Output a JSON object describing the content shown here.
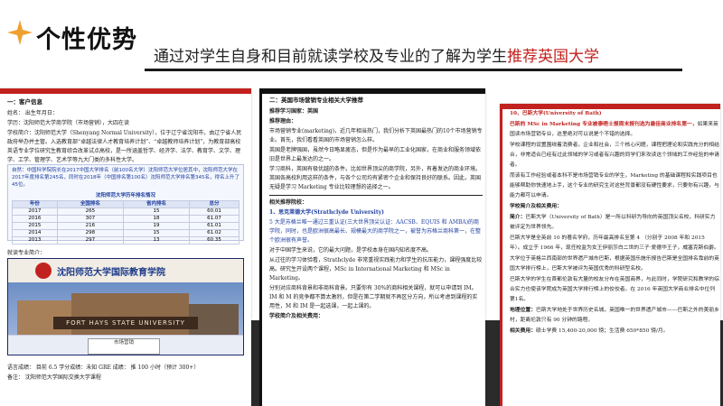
{
  "header": {
    "title": "个性优势",
    "subtitle_plain": "通过对学生自身和目前就读学校及专业的了解为学生",
    "subtitle_highlight": "推荐英国大学",
    "accent_color": "#c2221f",
    "spark_icon": "sparkle-icon"
  },
  "card1": {
    "section_title": "一：客户信息",
    "name_line": "姓名：       出生年月日：",
    "school_line": "学历：沈阳师范大学商学院（市场营销），大四在读",
    "intro_label": "学校简介：",
    "intro_text": "沈阳师范大学（Shenyang Normal University），位于辽宁省沈阳市，由辽宁省人民政府举办并主管。入选教育部“卓越法律人才教育培养计划”、“卓越教师培养计划”，为教育部高校英语专业学位研究生教育综合改革试点高校，是一所涵盖哲学、经济学、法学、教育学、文学、理学、工学、管理学、艺术学等九大门类的多科性大学。",
    "box_intro": "自然：中国科学院院长在2017中国大学排名（前100名大学）沈阳师范大学位居其中，沈阳师范大学在2017年度排名第245名，同时在2018年（中国排名第100名）沈阳师范大学排名第345名，得名上升了45位。",
    "table_title": "沈阳师范大学历年排名情况",
    "table_headers": [
      "年份",
      "全国排名",
      "省内排名",
      "总分"
    ],
    "table_rows": [
      [
        "2017",
        "265",
        "15",
        "60.01"
      ],
      [
        "2016",
        "307",
        "18",
        "61.07"
      ],
      [
        "2015",
        "216",
        "19",
        "61.01"
      ],
      [
        "2014",
        "298",
        "15",
        "61.02"
      ],
      [
        "2013",
        "297",
        "13",
        "60.35"
      ]
    ],
    "lower_label": "就读专业简介：",
    "campus_logo_text": "沈阳师范大学国际教育学院",
    "campus_sign": "FORT HAYS STATE UNIVERSITY",
    "strip_text": "市场营销",
    "footer_line1": "语言成绩：  目前 6.5     学分成绩：未知     GRE 成绩：  推 100 小时（预计 300+）",
    "footer_line2": "备注：        沈阳师范大学国际交换大学课程"
  },
  "card2": {
    "section_title": "二：英国市场营销专业相关大学推荐",
    "recommend_country_label": "推荐学习国家：英国",
    "recommend_reason_label": "推荐理由：",
    "para1": "市场营销专业(marketing)，近几年相当热门，我们分析下英国最热门的10个市场营销专业。首先，我们看看英国的市场营销怎么样。",
    "para2": "英国是老牌强国，虽然今日略显疲态，但是作为最早的工业化国家，在商业和服务领域依旧是世界上最发达的之一。",
    "para3": "学习商科，英国有极优越的条件。比如世界顶尖的商学院，另外，有着发达的商业环境。英国各高校利用这样的条件，与各个公司均有紧密个企业和保持良好的联系。因此，英国无疑是学习 Marketing 专业比较理想的选择之一。",
    "related_title": "相关推荐院校：",
    "school_heading": "1、思克莱德大学(Strathclyde University)",
    "school_text1": "5 大是苏格兰唯一通过三重认证(三大世界顶尖认证：AACSB、EQUIS 和 AMBA)的商学院，同时，也是欧洲很高最长、规模最大的商学院之一，被誉为苏格兰商科第一，在整个欧洲很有声誉。",
    "school_text2": "对于中国学生来说，它的最大问题，是学校本身在国内知名度不高。",
    "school_text3": "从过往的学习体验看，Strathclyde 非常重视实践能力和学生的抗压能力，课程强度比较高。研究生开设两个课程，MSc in International Marketing 和 MSc in Marketing。",
    "school_text4": "分别对应商科背景和非商科背景。只要你有 30%的商科相关课程，就可以申请到 IM。IM 和 M 的竞争都不算太激烈，但是在第二学期就不再区分方向，所以考虑到课程的实用性，M 和 IM 是一起选课，一起上课的。",
    "bottom_label": "学校简介及相关费用："
  },
  "card3": {
    "heading": "10、巴斯大学(University of Bath)",
    "sub": "巴斯的 MSc in Marketing 专业被泰晤士报周末报刊选为最佳商业排名第一，",
    "para1_tail": "如果来英国读市场营销专业，这里绝对可以说是个不错的选择。",
    "para2": "学校课程的设置围绕着消费者，企业和社会，三个核心问题，课程把理论和实践充分的相结合，非常适合已经有过此领域的学习或者有兴趣的同学们来攻读这个领域的工作经验的申请者。",
    "para3": "而该有工作经验或者本科不是市场营销专业的学生，Marketing 的基础课程和实践项目也能够帮助你快速地上手，这个专业的研究生对这些背景都没有硬性要求，只要你有兴趣，与能力都可以申请。",
    "intro_label": "学校简介及相关费用：",
    "intro_bold": "简介：",
    "intro_text": "巴斯大学（University of Bath）是一所以科研为导向的英国顶尖名校，科研实力被评定为世界领先。",
    "para4": "巴斯大学是全英前 10 的著名学府，历年最高排名至第 4 （分别于 2008 年和 2015 年）。成立于 1966 年，现任校监为女王伊丽莎白二世的三子·爱德华王子，威塞克斯伯爵。",
    "para5": "大学位于英格兰西南部的世界遗产城市巴斯，根据英国乐施乐报告巴斯是全国排名靠前的英国大学排行榜上，巴斯大学被评为英国优秀的科研型名校。",
    "para6": "巴斯大学的学生在首都伦敦有大量的校友分布在英国商界，与此同时，学院研究和教学的综合实力也使该学院成为英国大学排行榜上的佼佼者。在 2016 年英国大学商业排名中位列第1名。",
    "location_bold": "地理位置：",
    "location_text": "巴斯大学地处于世界历史名城，英国唯一的世界遗产城市——巴斯之外的美丽乡村，距离伦敦只有 90 分钟的路程。",
    "fees_bold": "相关费用：",
    "fees_text": "硕士学费 15,400-20,000 镑；生活费 650*850 镑/月。"
  },
  "colors": {
    "bottom_band": "#2b2b2b",
    "accent_red": "#c2221f",
    "school_blue": "#1f3fa0"
  }
}
